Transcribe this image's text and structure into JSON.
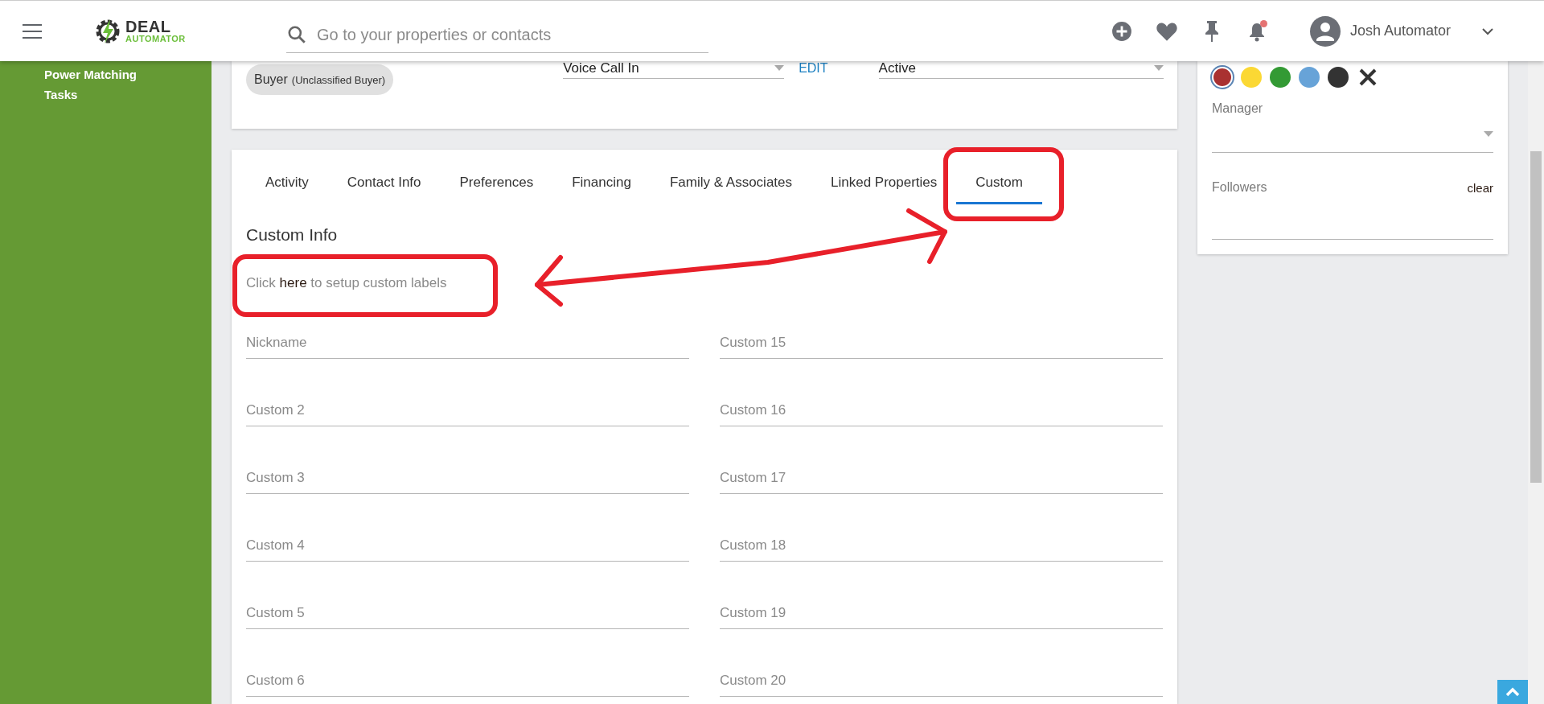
{
  "header": {
    "logo": {
      "line_1": "DEAL",
      "line_2": "AUTOMATOR"
    },
    "search": {
      "placeholder": "Go to your properties or contacts"
    },
    "notifications_unread": true,
    "user": {
      "name": "Josh Automator"
    }
  },
  "sidebar": {
    "items": [
      {
        "label": "Power Matching"
      },
      {
        "label": "Tasks"
      }
    ]
  },
  "contact_card": {
    "type_chip": {
      "label": "Buyer",
      "detail": "(Unclassified Buyer)"
    },
    "source": {
      "value": "Voice Call In"
    },
    "edit_link": "EDIT",
    "status": {
      "value": "Active"
    }
  },
  "tabs": [
    {
      "label": "Activity",
      "selected": false
    },
    {
      "label": "Contact Info",
      "selected": false
    },
    {
      "label": "Preferences",
      "selected": false
    },
    {
      "label": "Financing",
      "selected": false
    },
    {
      "label": "Family & Associates",
      "selected": false
    },
    {
      "label": "Linked Properties",
      "selected": false
    },
    {
      "label": "Custom",
      "selected": true
    }
  ],
  "custom_info": {
    "title": "Custom Info",
    "setup_hint": {
      "before": "Click",
      "link": "here",
      "after": "to setup custom labels"
    },
    "fields_left": [
      {
        "placeholder": "Nickname"
      },
      {
        "placeholder": "Custom 2"
      },
      {
        "placeholder": "Custom 3"
      },
      {
        "placeholder": "Custom 4"
      },
      {
        "placeholder": "Custom 5"
      },
      {
        "placeholder": "Custom 6"
      }
    ],
    "fields_right": [
      {
        "placeholder": "Custom 15"
      },
      {
        "placeholder": "Custom 16"
      },
      {
        "placeholder": "Custom 17"
      },
      {
        "placeholder": "Custom 18"
      },
      {
        "placeholder": "Custom 19"
      },
      {
        "placeholder": "Custom 20"
      }
    ]
  },
  "side_panel": {
    "colors": [
      {
        "color": "#a93131",
        "selected": true
      },
      {
        "color": "#fbd834",
        "selected": false
      },
      {
        "color": "#339a34",
        "selected": false
      },
      {
        "color": "#67a3d8",
        "selected": false
      },
      {
        "color": "#333333",
        "selected": false
      }
    ],
    "manager": {
      "label": "Manager"
    },
    "followers": {
      "label": "Followers",
      "clear": "clear"
    }
  }
}
